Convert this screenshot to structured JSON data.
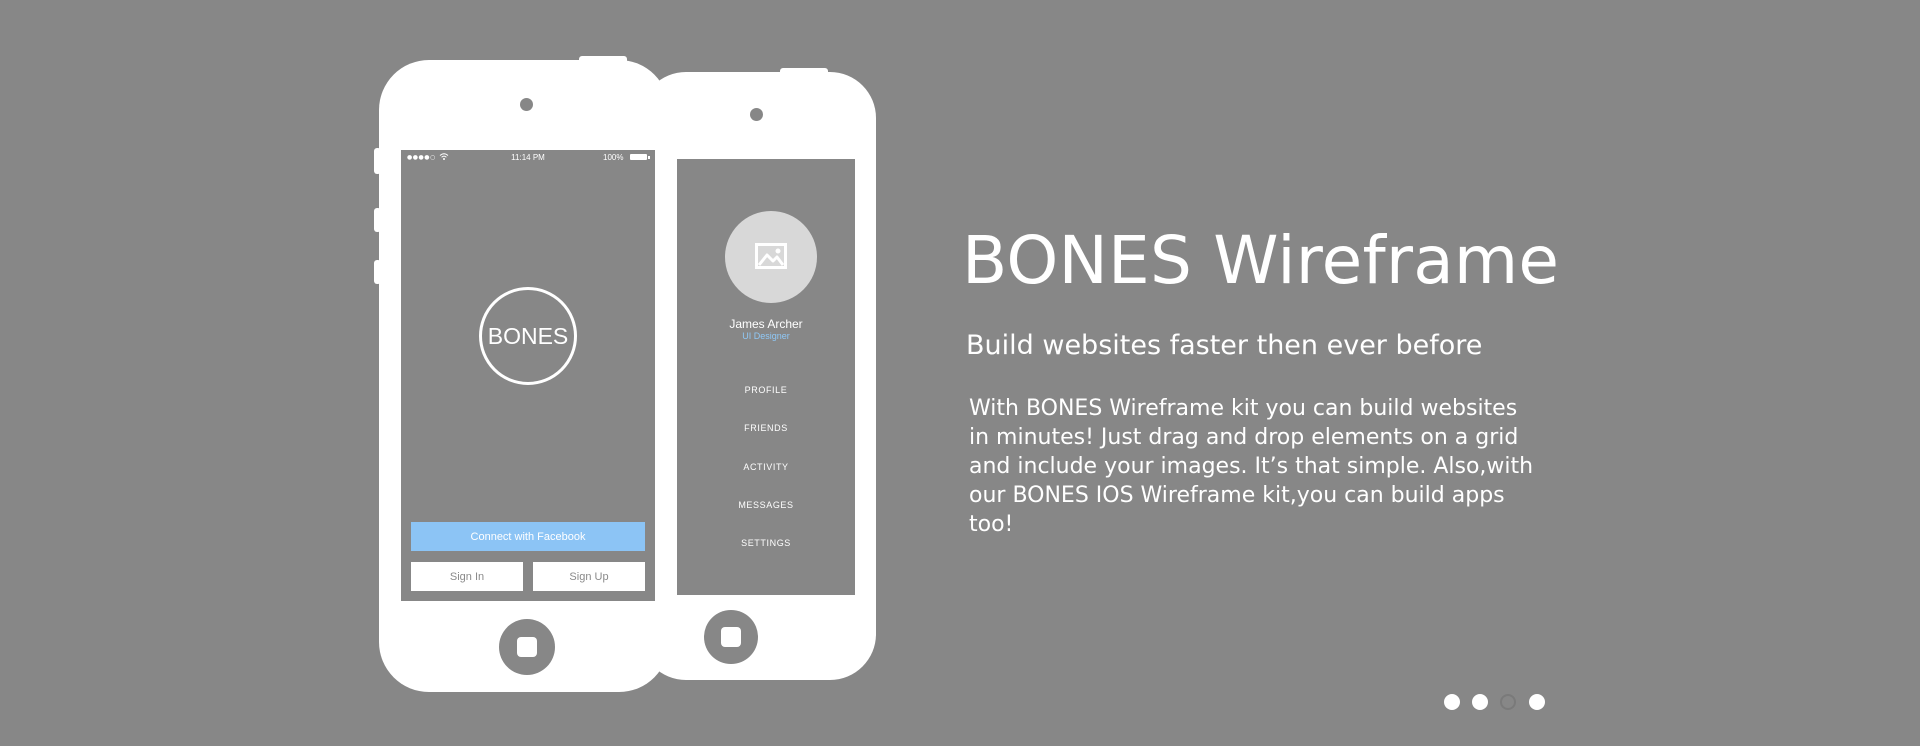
{
  "colors": {
    "background": "#878787",
    "phone": "#ffffff",
    "accent": "#8cc4f5",
    "role_text": "#8fc8f6"
  },
  "login_screen": {
    "status_bar": {
      "signal": "●●●●○",
      "time": "11:14 PM",
      "battery": "100%"
    },
    "logo_text": "BONES",
    "facebook_button": "Connect with Facebook",
    "sign_in_button": "Sign In",
    "sign_up_button": "Sign Up"
  },
  "menu_screen": {
    "avatar_icon": "image-placeholder-icon",
    "user_name": "James Archer",
    "user_role": "UI Designer",
    "menu_items": [
      {
        "label": "PROFILE"
      },
      {
        "label": "FRIENDS"
      },
      {
        "label": "ACTIVITY"
      },
      {
        "label": "MESSAGES"
      },
      {
        "label": "SETTINGS"
      }
    ]
  },
  "hero": {
    "title": "BONES Wireframe",
    "subtitle": "Build websites faster then ever before",
    "body": "With BONES Wireframe kit you can build websites in minutes! Just drag and drop elements on a grid and include your images. It’s that simple. Also,with our BONES IOS Wireframe kit,you can build apps too!"
  },
  "pagination": {
    "total": 4,
    "active_index": 2
  }
}
